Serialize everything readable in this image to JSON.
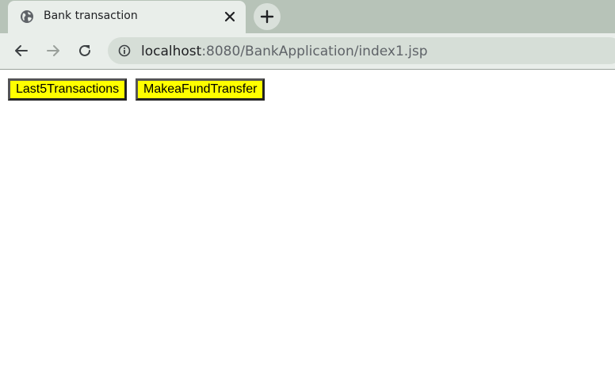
{
  "browser": {
    "tab": {
      "title": "Bank transaction",
      "favicon_icon": "globe-icon",
      "close_icon": "close-icon"
    },
    "new_tab_icon": "plus-icon",
    "nav": {
      "back_icon": "arrow-left-icon",
      "forward_icon": "arrow-right-icon",
      "reload_icon": "reload-icon"
    },
    "address_bar": {
      "info_icon": "info-icon",
      "host": "localhost",
      "path": ":8080/BankApplication/index1.jsp"
    }
  },
  "page": {
    "buttons": [
      {
        "label": "Last5Transactions"
      },
      {
        "label": "MakeaFundTransfer"
      }
    ]
  },
  "colors": {
    "tabstrip": "#b7c3b8",
    "toolbar": "#e9eeea",
    "button_background": "#ffff00"
  }
}
